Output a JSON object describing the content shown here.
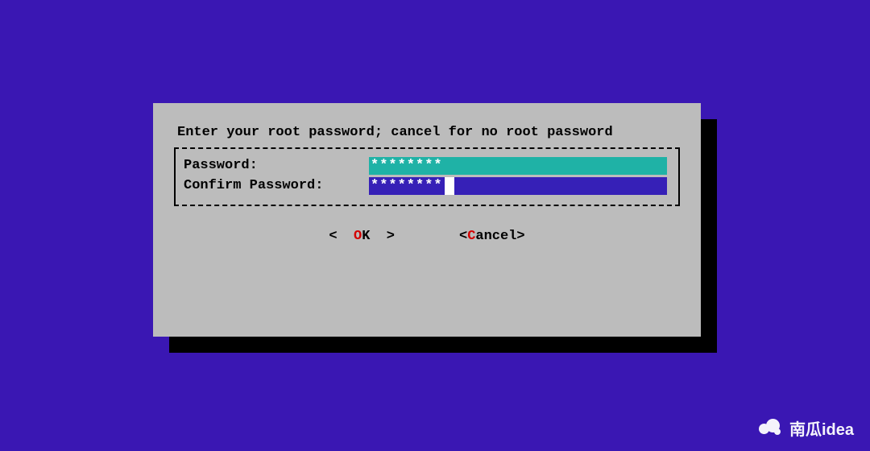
{
  "dialog": {
    "prompt": "Enter your root password; cancel for no root password",
    "fields": {
      "password": {
        "label": "Password:",
        "value": "********"
      },
      "confirm": {
        "label": "Confirm Password:",
        "value": "********"
      }
    },
    "buttons": {
      "ok": {
        "hotkey": "O",
        "rest": "K"
      },
      "cancel": {
        "hotkey": "C",
        "rest": "ancel"
      }
    }
  },
  "watermark": {
    "text": "南瓜idea"
  },
  "colors": {
    "background": "#3a17b3",
    "panel": "#bcbcbc",
    "field_active": "#1fb2a6",
    "field_inactive": "#3620b7",
    "hotkey": "#d40000"
  }
}
